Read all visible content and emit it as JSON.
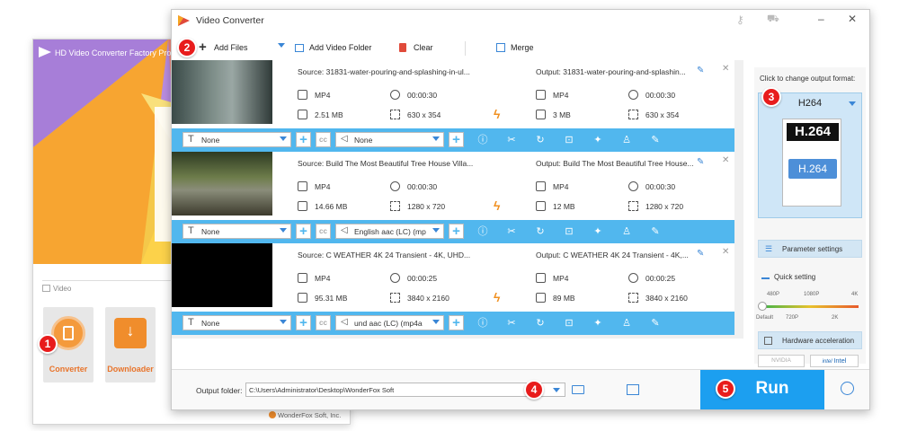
{
  "launcher": {
    "title": "HD Video Converter Factory Pro",
    "section": "Video",
    "tiles": [
      {
        "label": "Converter"
      },
      {
        "label": "Downloader"
      }
    ],
    "footer": "WonderFox Soft, Inc."
  },
  "window": {
    "title": "Video Converter"
  },
  "toolbar": {
    "add_files": "Add Files",
    "add_folder": "Add Video Folder",
    "clear": "Clear",
    "merge": "Merge"
  },
  "badges": [
    "1",
    "2",
    "3",
    "4",
    "5"
  ],
  "rows": [
    {
      "source": "Source: 31831-water-pouring-and-splashing-in-ul...",
      "output": "Output: 31831-water-pouring-and-splashin...",
      "src_format": "MP4",
      "src_duration": "00:00:30",
      "src_size": "2.51 MB",
      "src_res": "630 x 354",
      "out_format": "MP4",
      "out_duration": "00:00:30",
      "out_size": "3 MB",
      "out_res": "630 x 354",
      "subtitle": "None",
      "audio": "None"
    },
    {
      "source": "Source: Build The Most Beautiful Tree House Villa...",
      "output": "Output: Build The Most Beautiful Tree House...",
      "src_format": "MP4",
      "src_duration": "00:00:30",
      "src_size": "14.66 MB",
      "src_res": "1280 x 720",
      "out_format": "MP4",
      "out_duration": "00:00:30",
      "out_size": "12 MB",
      "out_res": "1280 x 720",
      "subtitle": "None",
      "audio": "English aac (LC) (mp"
    },
    {
      "source": "Source: C  WEATHER  4K 24  Transient - 4K, UHD...",
      "output": "Output: C  WEATHER  4K 24  Transient - 4K,...",
      "src_format": "MP4",
      "src_duration": "00:00:25",
      "src_size": "95.31 MB",
      "src_res": "3840 x 2160",
      "out_format": "MP4",
      "out_duration": "00:00:25",
      "out_size": "89 MB",
      "out_res": "3840 x 2160",
      "subtitle": "None",
      "audio": "und aac (LC) (mp4a"
    }
  ],
  "panel": {
    "hint": "Click to change output format:",
    "format": "H264",
    "logo_text": "H.264",
    "param_btn": "Parameter settings",
    "quick": "Quick setting",
    "ticks_top": [
      "480P",
      "1080P",
      "4K"
    ],
    "ticks_bottom": [
      "Default",
      "720P",
      "2K"
    ],
    "hw": "Hardware acceleration",
    "nvidia": "NVIDIA",
    "intel": "Intel"
  },
  "bottom": {
    "label": "Output folder:",
    "path": "C:\\Users\\Administrator\\Desktop\\WonderFox Soft",
    "run": "Run"
  },
  "colors": {
    "accent": "#51b7ee",
    "run": "#1c9ff0",
    "badge": "#e81c1c",
    "orange": "#f09020"
  }
}
